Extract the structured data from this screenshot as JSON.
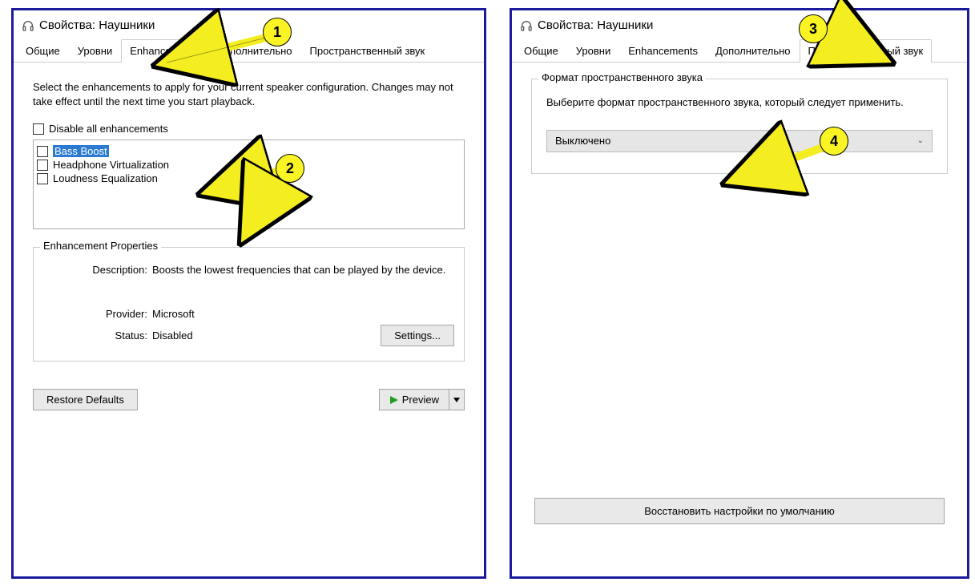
{
  "left": {
    "title": "Свойства: Наушники",
    "tabs": [
      "Общие",
      "Уровни",
      "Enhancements",
      "Дополнительно",
      "Пространственный звук"
    ],
    "active_tab": 2,
    "intro": "Select the enhancements to apply for your current speaker configuration. Changes may not take effect until the next time you start playback.",
    "disable_all": "Disable all enhancements",
    "enh": [
      "Bass Boost",
      "Headphone Virtualization",
      "Loudness Equalization"
    ],
    "props_legend": "Enhancement Properties",
    "desc_label": "Description:",
    "desc_value": "Boosts the lowest frequencies that can be played by the device.",
    "provider_label": "Provider:",
    "provider_value": "Microsoft",
    "status_label": "Status:",
    "status_value": "Disabled",
    "settings_btn": "Settings...",
    "restore_btn": "Restore Defaults",
    "preview_btn": "Preview"
  },
  "right": {
    "title": "Свойства: Наушники",
    "tabs": [
      "Общие",
      "Уровни",
      "Enhancements",
      "Дополнительно",
      "Пространственный звук"
    ],
    "active_tab": 4,
    "legend": "Формат пространственного звука",
    "desc": "Выберите формат пространственного звука, который следует применить.",
    "dd_value": "Выключено",
    "restore_btn": "Восстановить настройки по умолчанию"
  },
  "badges": {
    "b1": "1",
    "b2": "2",
    "b3": "3",
    "b4": "4"
  }
}
